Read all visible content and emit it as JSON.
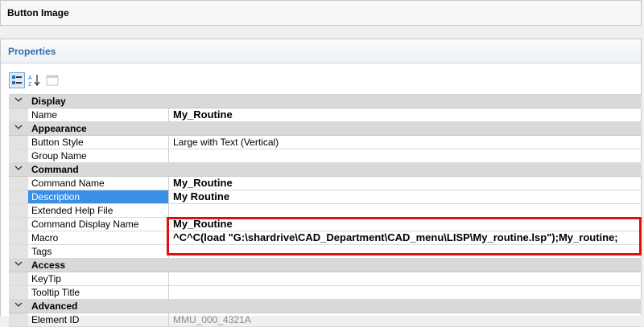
{
  "top_panel": {
    "title": "Button Image"
  },
  "properties_panel": {
    "title": "Properties",
    "toolbar": [
      {
        "icon": "categorized-icon",
        "active": true
      },
      {
        "icon": "sort-alphabetical-icon",
        "active": false
      },
      {
        "icon": "property-pages-icon",
        "active": false,
        "disabled": true
      }
    ]
  },
  "grid": {
    "categories": [
      {
        "label": "Display",
        "props": [
          {
            "name": "Name",
            "value": "My_Routine",
            "bold": true
          }
        ]
      },
      {
        "label": "Appearance",
        "props": [
          {
            "name": "Button Style",
            "value": "Large with Text (Vertical)"
          },
          {
            "name": "Group Name",
            "value": ""
          }
        ]
      },
      {
        "label": "Command",
        "props": [
          {
            "name": "Command Name",
            "value": "My_Routine",
            "bold": true
          },
          {
            "name": "Description",
            "value": "My Routine",
            "bold": true,
            "selected": true
          },
          {
            "name": "Extended Help File",
            "value": ""
          },
          {
            "name": "Command Display Name",
            "value": "My_Routine",
            "bold": true
          },
          {
            "name": "Macro",
            "value": "^C^C(load \"G:\\shardrive\\CAD_Department\\CAD_menu\\LISP\\My_routine.lsp\");My_routine;",
            "bold": true
          },
          {
            "name": "Tags",
            "value": ""
          }
        ]
      },
      {
        "label": "Access",
        "props": [
          {
            "name": "KeyTip",
            "value": ""
          },
          {
            "name": "Tooltip Title",
            "value": ""
          }
        ]
      },
      {
        "label": "Advanced",
        "props": [
          {
            "name": "Element ID",
            "value": "MMU_000_4321A",
            "grey": true
          }
        ]
      }
    ]
  },
  "colors": {
    "highlight": "#e01010",
    "selection": "#3a8ee6",
    "panel_title": "#2f6db5"
  }
}
